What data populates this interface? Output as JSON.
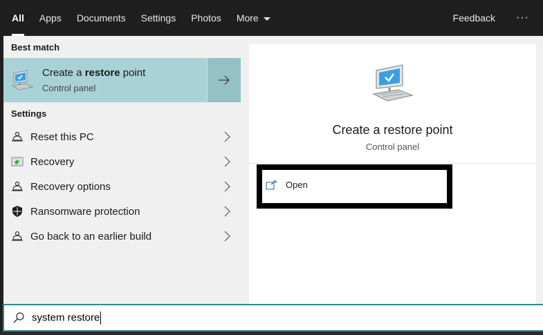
{
  "tabs": [
    {
      "label": "All",
      "active": true
    },
    {
      "label": "Apps",
      "active": false
    },
    {
      "label": "Documents",
      "active": false
    },
    {
      "label": "Settings",
      "active": false
    },
    {
      "label": "Photos",
      "active": false
    },
    {
      "label": "More",
      "active": false
    }
  ],
  "topbar": {
    "feedback": "Feedback",
    "dots": "···"
  },
  "left": {
    "best_match_heading": "Best match",
    "best_match": {
      "title_prefix": "Create a ",
      "title_bold": "restore",
      "title_suffix": " point",
      "subtitle": "Control panel",
      "icon": "computer-icon"
    },
    "settings_heading": "Settings",
    "settings_items": [
      {
        "label": "Reset this PC",
        "icon": "reset-pc-icon"
      },
      {
        "label": "Recovery",
        "icon": "recovery-icon"
      },
      {
        "label": "Recovery options",
        "icon": "recovery-options-icon"
      },
      {
        "label": "Ransomware protection",
        "icon": "shield-icon"
      },
      {
        "label": "Go back to an earlier build",
        "icon": "go-back-icon"
      }
    ]
  },
  "right": {
    "title": "Create a restore point",
    "subtitle": "Control panel",
    "action": {
      "label": "Open",
      "icon": "open-icon"
    }
  },
  "search": {
    "value": "system restore",
    "icon": "search-icon"
  },
  "colors": {
    "accent": "#2a8c93",
    "best_match_bg": "#a9d2d6",
    "topbar_bg": "#1f1f1f",
    "pane_bg": "#f0f0f0"
  }
}
